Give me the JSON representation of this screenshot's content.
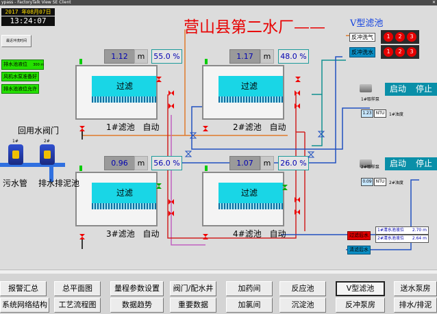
{
  "titlebar": {
    "title": "ypass - FactoryTalk View SE Client",
    "close_glyph": "✕"
  },
  "header": {
    "date": "2017 年08月07日",
    "time": "13:24:07",
    "title": "营山县第二水厂——",
    "subtitle": "V型滤池",
    "reset_button": "最近冲洗时间"
  },
  "status_labels": {
    "drain_pool_level": "排水池液位",
    "drain_pool_level_value": "300 m",
    "fan_pump_ready": "风机水泵准备好",
    "drain_level_allowed": "排水池液位允许"
  },
  "filters": [
    {
      "name": "1#滤池",
      "mode": "自动",
      "level": "1.12",
      "unit": "m",
      "pct": "55.0 %",
      "state": "过滤"
    },
    {
      "name": "2#滤池",
      "mode": "自动",
      "level": "1.17",
      "unit": "m",
      "pct": "48.0 %",
      "state": "过滤"
    },
    {
      "name": "3#滤池",
      "mode": "自动",
      "level": "0.96",
      "unit": "m",
      "pct": "56.0 %",
      "state": "过滤"
    },
    {
      "name": "4#滤池",
      "mode": "自动",
      "level": "1.07",
      "unit": "m",
      "pct": "26.0 %",
      "state": "过滤"
    }
  ],
  "left_area": {
    "return_valve": "回用水阀门",
    "valve1": "1#",
    "valve2": "2#",
    "sewer": "污水管",
    "drain_mud": "排水排泥池"
  },
  "right_area": {
    "backwash_air": "反冲洗气",
    "backwash_water": "反冲洗水",
    "air_circles": [
      "1",
      "2",
      "3"
    ],
    "water_circles": [
      "1",
      "2",
      "3"
    ],
    "pump1": {
      "start": "启动",
      "stop": "停止",
      "name": "1#取样泵",
      "value": "1.23",
      "unit": "NTU",
      "label": "1#浊度"
    },
    "pump2": {
      "start": "启动",
      "stop": "停止",
      "name": "2#取样泵",
      "value": "0.09",
      "unit": "NTU",
      "label": "2#浊度"
    },
    "before_filter": "过滤后水",
    "after_filter": "清滤后水",
    "clear1_label": "1#清水池液位",
    "clear1_value": "2.70 m",
    "clear2_label": "2#清水池液位",
    "clear2_value": "2.64 m"
  },
  "nav": {
    "row1": [
      "报警汇总",
      "总平面图",
      "量程参数设置",
      "阀门/配水井",
      "加药间",
      "反应池",
      "V型滤池",
      "送水泵房"
    ],
    "row2": [
      "系统网络结构",
      "工艺流程图",
      "数据趋势",
      "重要数据",
      "加氯间",
      "沉淀池",
      "反冲泵房",
      "排水/排泥"
    ]
  },
  "colors": {
    "accent_red": "#e80000",
    "water": "#19d6e6",
    "status_green": "#24e000",
    "pipe_blue": "#2050c0"
  }
}
